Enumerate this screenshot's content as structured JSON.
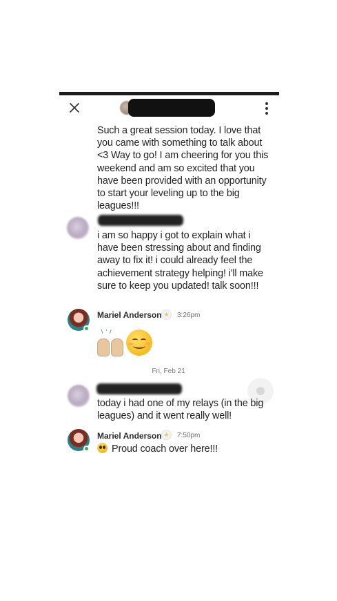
{
  "header": {
    "close_icon": "close-icon",
    "more_icon": "more-vertical-icon",
    "contact_name_redacted": true
  },
  "messages": [
    {
      "sender_redacted": true,
      "text": "Such a great session today. I love that you came with something to talk about <3 Way to go! I am cheering for you this weekend and am so excited that you have been provided with an opportunity to start your leveling up to the big leagues!!!"
    },
    {
      "sender_redacted": true,
      "text": "i am so happy i got to explain what i have been stressing about and finding away to fix it! i could already feel the achievement strategy helping!  i'll make sure to keep you updated! talk soon!!!"
    },
    {
      "sender": "Mariel Anderson",
      "time": "3:26pm",
      "emojis": [
        "raising-hands-emoji",
        "smiling-face-emoji"
      ]
    }
  ],
  "date_separator": "Fri, Feb 21",
  "messages2": [
    {
      "sender_redacted": true,
      "text": "today i had one of my relays (in the big leagues) and it went really well!"
    },
    {
      "sender": "Mariel Anderson",
      "time": "7:50pm",
      "text": "Proud coach over here!!!",
      "leading_emoji": "pleading-face-emoji"
    }
  ],
  "colors": {
    "online": "#2fb34a",
    "text": "#222222",
    "timestamp": "#6b6b6b"
  }
}
